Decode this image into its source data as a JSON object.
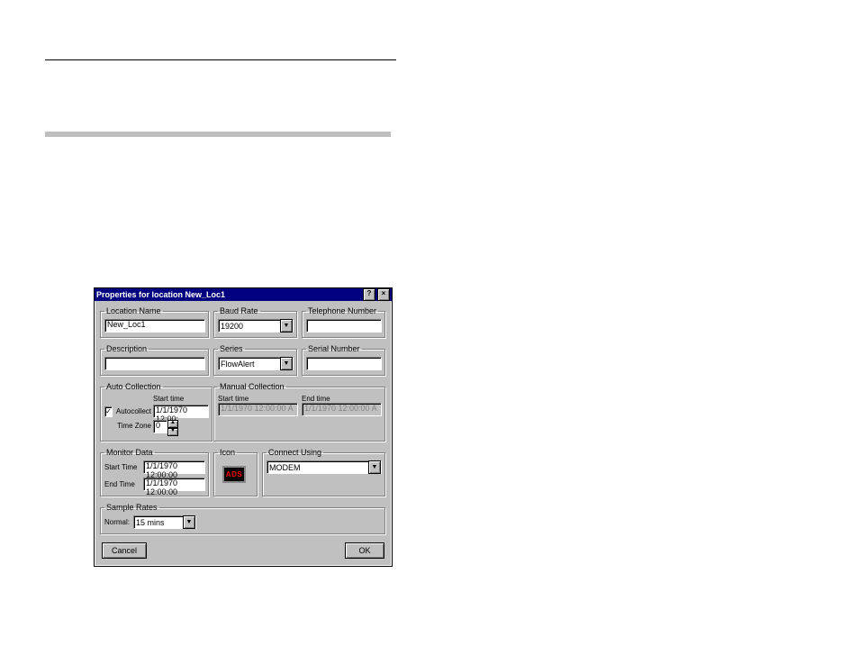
{
  "dialog": {
    "title": "Properties for location New_Loc1",
    "groups": {
      "location_name": {
        "legend": "Location Name",
        "value": "New_Loc1"
      },
      "baud_rate": {
        "legend": "Baud Rate",
        "value": "19200"
      },
      "telephone": {
        "legend": "Telephone Number",
        "value": ""
      },
      "description": {
        "legend": "Description",
        "value": ""
      },
      "series": {
        "legend": "Series",
        "value": "FlowAlert"
      },
      "serial_number": {
        "legend": "Serial Number",
        "value": ""
      },
      "auto_collection": {
        "legend": "Auto Collection",
        "autocollect_label": "Autocollect",
        "autocollect_checked": true,
        "start_time_label": "Start time",
        "start_time_value": "1/1/1970 12:00:",
        "time_zone_label": "Time Zone",
        "time_zone_value": "0"
      },
      "manual_collection": {
        "legend": "Manual Collection",
        "start_label": "Start time",
        "start_value": "1/1/1970 12:00:00 A",
        "end_label": "End time",
        "end_value": "1/1/1970 12:00:00 A"
      },
      "monitor_data": {
        "legend": "Monitor Data",
        "start_label": "Start Time",
        "start_value": "1/1/1970 12:00:00",
        "end_label": "End Time",
        "end_value": "1/1/1970 12:00:00"
      },
      "icon": {
        "legend": "Icon",
        "badge": "ADS"
      },
      "connect_using": {
        "legend": "Connect Using",
        "value": "MODEM"
      },
      "sample_rates": {
        "legend": "Sample Rates",
        "normal_label": "Normal:",
        "normal_value": "15 mins"
      }
    },
    "buttons": {
      "cancel": "Cancel",
      "ok": "OK"
    },
    "titlebar_help": "?",
    "titlebar_close": "×"
  }
}
